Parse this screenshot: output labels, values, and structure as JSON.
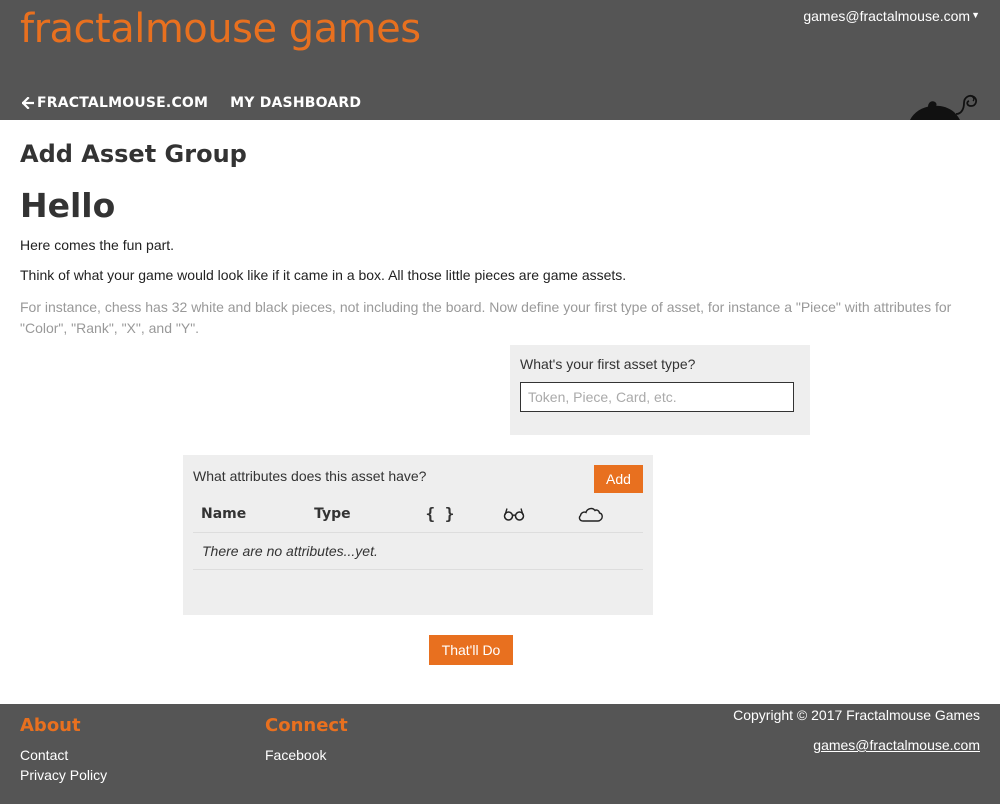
{
  "header": {
    "brand": "fractalmouse games",
    "account_email": "games@fractalmouse.com",
    "nav": {
      "site_link": "FRACTALMOUSE.COM",
      "dashboard_link": "MY DASHBOARD"
    }
  },
  "main": {
    "page_title": "Add Asset Group",
    "greeting": "Hello",
    "intro": "Here comes the fun part.",
    "explanation": "Think of what your game would look like if it came in a box. All those little pieces are game assets.",
    "example": "For instance, chess has 32 white and black pieces, not including the board. Now define your first type of asset, for instance a \"Piece\" with attributes for \"Color\", \"Rank\", \"X\", and \"Y\".",
    "asset_type": {
      "label": "What's your first asset type?",
      "value": "",
      "placeholder": "Token, Piece, Card, etc."
    },
    "attributes": {
      "question": "What attributes does this asset have?",
      "add_label": "Add",
      "columns": [
        {
          "label": "Name"
        },
        {
          "label": "Type"
        },
        {
          "icon": "braces-icon",
          "glyph": "{ }"
        },
        {
          "icon": "glasses-icon"
        },
        {
          "icon": "cloud-icon"
        }
      ],
      "empty_message": "There are no attributes...yet."
    },
    "done_label": "That'll Do"
  },
  "footer": {
    "about": {
      "heading": "About",
      "links": [
        "Contact",
        "Privacy Policy"
      ]
    },
    "connect": {
      "heading": "Connect",
      "links": [
        "Facebook"
      ]
    },
    "copyright": "Copyright © 2017 Fractalmouse Games",
    "email": "games@fractalmouse.com"
  },
  "colors": {
    "brand_orange": "#e8701f",
    "header_bg": "#555555",
    "panel_bg": "#eeeeee",
    "muted_text": "#999999"
  }
}
